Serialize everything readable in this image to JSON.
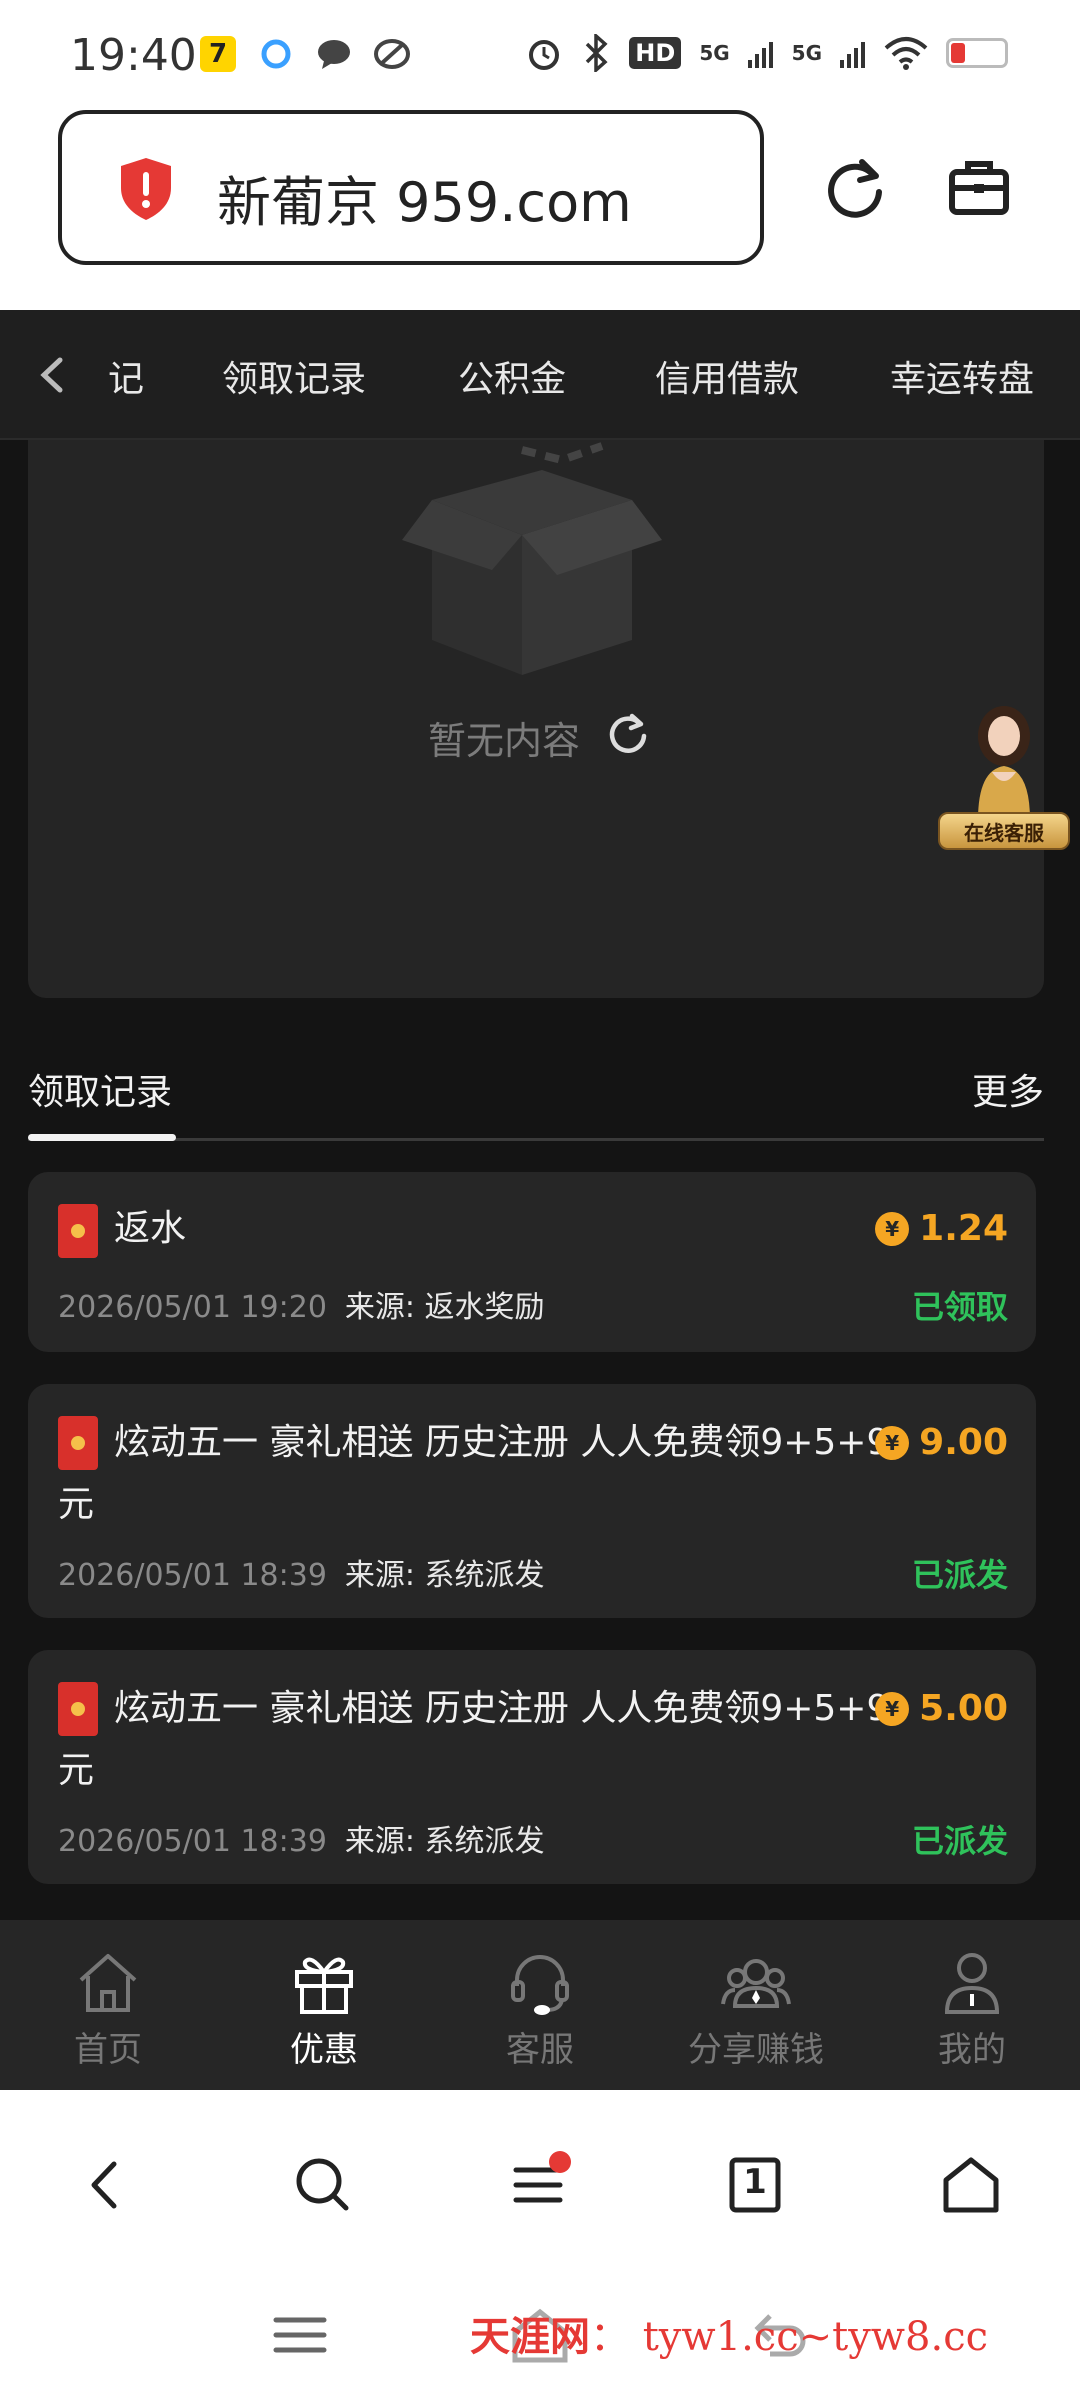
{
  "status_bar": {
    "time": "19:40",
    "app_icons": [
      "qq-icon",
      "browser-icon",
      "message-icon",
      "app-icon"
    ],
    "hd_label": "HD",
    "signal1": "5G",
    "signal2": "5G"
  },
  "url_bar": {
    "url": "新葡京 959.com"
  },
  "tabs": {
    "partial": "记",
    "items": [
      "领取记录",
      "公积金",
      "信用借款",
      "幸运转盘"
    ]
  },
  "empty_state": {
    "text": "暂无内容"
  },
  "floating_cs": {
    "label": "在线客服"
  },
  "records_section": {
    "title": "领取记录",
    "more": "更多"
  },
  "records": [
    {
      "title": "返水",
      "amount": "1.24",
      "date": "2026/05/01 19:20",
      "source": "来源: 返水奖励",
      "status": "已领取"
    },
    {
      "title": "炫动五一 豪礼相送 历史注册 人人免费领9+5+9元",
      "amount": "9.00",
      "date": "2026/05/01 18:39",
      "source": "来源: 系统派发",
      "status": "已派发"
    },
    {
      "title": "炫动五一 豪礼相送 历史注册 人人免费领9+5+9元",
      "amount": "5.00",
      "date": "2026/05/01 18:39",
      "source": "来源: 系统派发",
      "status": "已派发"
    }
  ],
  "bottom_nav": [
    {
      "label": "首页",
      "icon": "home-icon"
    },
    {
      "label": "优惠",
      "icon": "gift-icon",
      "active": true
    },
    {
      "label": "客服",
      "icon": "headset-icon"
    },
    {
      "label": "分享赚钱",
      "icon": "share-icon"
    },
    {
      "label": "我的",
      "icon": "user-icon"
    }
  ],
  "browser_nav": {
    "tab_count": "1"
  },
  "watermark": {
    "brand": "天涯网",
    "sep": "：",
    "domains": "tyw1.cc~tyw8.cc"
  },
  "colors": {
    "amount": "#f5a623",
    "status": "#2fc25b",
    "redpack": "#d8302b",
    "background": "#141414",
    "card": "#262626"
  }
}
